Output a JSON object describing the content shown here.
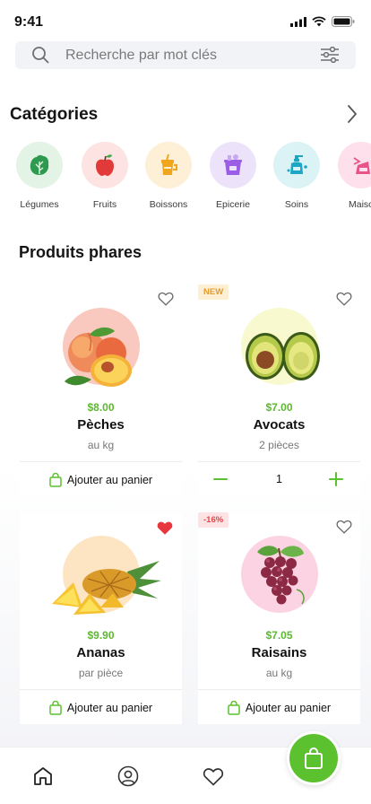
{
  "status": {
    "time": "9:41"
  },
  "search": {
    "placeholder": "Recherche par mot clés",
    "value": ""
  },
  "categories": {
    "title": "Catégories",
    "items": [
      {
        "label": "Légumes",
        "icon": "lettuce-icon",
        "bg": "#e3f3e6",
        "color": "#2e9a4f"
      },
      {
        "label": "Fruits",
        "icon": "apple-icon",
        "bg": "#fde3e1",
        "color": "#e23a3a"
      },
      {
        "label": "Boissons",
        "icon": "drink-icon",
        "bg": "#fdf0d7",
        "color": "#f1a51c"
      },
      {
        "label": "Epicerie",
        "icon": "grocery-bag-icon",
        "bg": "#ece3fb",
        "color": "#9b5de5"
      },
      {
        "label": "Soins",
        "icon": "soap-bottle-icon",
        "bg": "#dcf3f6",
        "color": "#1ba6c6"
      },
      {
        "label": "Maiso",
        "icon": "cleaning-icon",
        "bg": "#fde0ec",
        "color": "#e8538a"
      }
    ]
  },
  "featured": {
    "title": "Produits phares",
    "add_to_cart_label": "Ajouter au panier",
    "products": [
      {
        "name": "Pèches",
        "price": "$8.00",
        "unit": "au kg",
        "badge": "",
        "favorite": false,
        "image": "peach-image",
        "img_bg": "#f9c9bf"
      },
      {
        "name": "Avocats",
        "price": "$7.00",
        "unit": "2 pièces",
        "badge": "NEW",
        "favorite": false,
        "image": "avocado-image",
        "img_bg": "#f9f9cf",
        "quantity": "1"
      },
      {
        "name": "Ananas",
        "price": "$9.90",
        "unit": "par pièce",
        "badge": "",
        "favorite": true,
        "image": "pineapple-image",
        "img_bg": "#fde5c3"
      },
      {
        "name": "Raisains",
        "price": "$7.05",
        "unit": "au kg",
        "badge": "-16%",
        "favorite": false,
        "image": "grapes-image",
        "img_bg": "#fbd3e2"
      }
    ]
  },
  "colors": {
    "accent": "#5cc12e",
    "price": "#5cb82f",
    "favorite": "#e8363f"
  },
  "tabbar": {
    "items": [
      "home-icon",
      "profile-icon",
      "favorites-icon"
    ],
    "cart": "cart-icon"
  }
}
